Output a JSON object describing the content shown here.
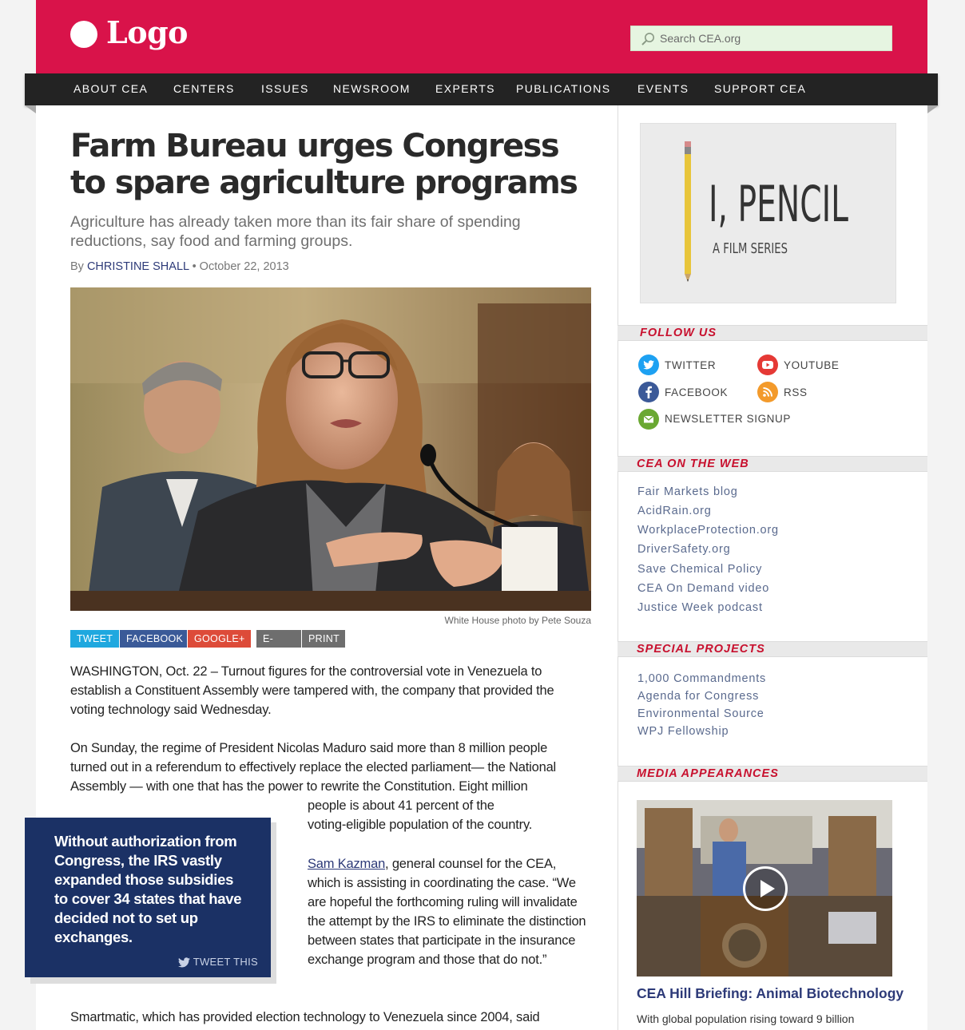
{
  "header": {
    "logo_text": "Logo",
    "search_placeholder": "Search CEA.org",
    "brand_color": "#d9134a"
  },
  "nav": {
    "items": [
      "ABOUT CEA",
      "CENTERS",
      "ISSUES",
      "NEWSROOM",
      "EXPERTS",
      "PUBLICATIONS",
      "EVENTS",
      "SUPPORT CEA"
    ]
  },
  "article": {
    "headline": "Farm Bureau urges Congress to spare agriculture programs",
    "subhead": "Agriculture has already taken more than its fair share of spending reductions, say food and farming groups.",
    "byline_prefix": "By",
    "author": "CHRISTINE SHALL",
    "date": "October 22, 2013",
    "photo_caption": "White House photo by Pete Souza",
    "share_buttons": [
      "TWEET",
      "FACEBOOK",
      "GOOGLE+",
      "E-MAIL",
      "PRINT"
    ],
    "p1": "WASHINGTON, Oct. 22 – Turnout figures for the controversial vote in Venezuela to establish a Constituent Assembly were tampered with, the company that provided the voting technology said Wednesday.",
    "p2_line1": "On Sunday, the regime of President Nicolas Maduro said more than 8 million people",
    "p2_line2": "turned out in a referendum to effectively replace the elected parliament— the National",
    "p2_line3": "Assembly — with one that has the power to rewrite the Constitution. Eight million",
    "p2_line4": "people is about 41 percent of the",
    "p2_line5": "voting-eligible population of the country.",
    "p3_link": "Sam Kazman",
    "p3_rest": ", general counsel for the CEA, which is assisting in coordinating the case. “We are hopeful the forthcoming ruling will invalidate the attempt by the IRS to eliminate the distinction between states that participate in the insurance exchange program and those that do not.”",
    "p4": "Smartmatic, which has provided election technology to Venezuela since 2004, said"
  },
  "pullquote": {
    "text": "Without authorization from Congress, the IRS vastly expanded those subsidies to cover 34 states that have decided not to set up exchanges.",
    "tweet_label": "TWEET THIS"
  },
  "sidebar": {
    "promo": {
      "title": "I, PENCIL",
      "subtitle": "A FILM SERIES"
    },
    "follow_title": "FOLLOW US",
    "social": [
      "TWITTER",
      "YOUTUBE",
      "FACEBOOK",
      "RSS",
      "NEWSLETTER SIGNUP"
    ],
    "web_title": "CEA ON THE WEB",
    "web_links": [
      "Fair Markets blog",
      "AcidRain.org",
      "WorkplaceProtection.org",
      "DriverSafety.org",
      "Save Chemical Policy",
      "CEA On Demand video",
      "Justice Week podcast"
    ],
    "projects_title": "SPECIAL PROJECTS",
    "project_links": [
      "1,000 Commandments",
      "Agenda for Congress",
      "Environmental Source",
      "WPJ Fellowship"
    ],
    "media_title": "MEDIA APPEARANCES",
    "video_title": "CEA Hill Briefing: Animal Biotechnology",
    "video_desc": "With global population rising toward 9 billion"
  }
}
